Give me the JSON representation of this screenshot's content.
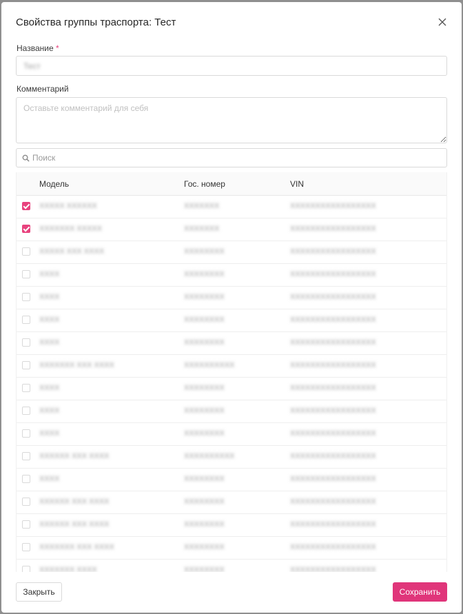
{
  "dialog": {
    "title": "Свойства группы траспорта: Тест",
    "name_label": "Название",
    "required_mark": "*",
    "name_value": "Тест",
    "comment_label": "Комментарий",
    "comment_placeholder": "Оставьте комментарий для себя",
    "search_placeholder": "Поиск",
    "close_label": "Закрыть",
    "save_label": "Сохранить"
  },
  "colors": {
    "accent": "#e0357a"
  },
  "table": {
    "columns": [
      "Модель",
      "Гос. номер",
      "VIN"
    ],
    "rows": [
      {
        "checked": true,
        "model": "XXXXX XXXXXX",
        "plate": "XXXXXXX",
        "vin": "XXXXXXXXXXXXXXXXX"
      },
      {
        "checked": true,
        "model": "XXXXXXX XXXXX",
        "plate": "XXXXXXX",
        "vin": "XXXXXXXXXXXXXXXXX"
      },
      {
        "checked": false,
        "model": "XXXXX XXX XXXX",
        "plate": "XXXXXXXX",
        "vin": "XXXXXXXXXXXXXXXXX"
      },
      {
        "checked": false,
        "model": "XXXX",
        "plate": "XXXXXXXX",
        "vin": "XXXXXXXXXXXXXXXXX"
      },
      {
        "checked": false,
        "model": "XXXX",
        "plate": "XXXXXXXX",
        "vin": "XXXXXXXXXXXXXXXXX"
      },
      {
        "checked": false,
        "model": "XXXX",
        "plate": "XXXXXXXX",
        "vin": "XXXXXXXXXXXXXXXXX"
      },
      {
        "checked": false,
        "model": "XXXX",
        "plate": "XXXXXXXX",
        "vin": "XXXXXXXXXXXXXXXXX"
      },
      {
        "checked": false,
        "model": "XXXXXXX XXX XXXX",
        "plate": "XXXXXXXXXX",
        "vin": "XXXXXXXXXXXXXXXXX"
      },
      {
        "checked": false,
        "model": "XXXX",
        "plate": "XXXXXXXX",
        "vin": "XXXXXXXXXXXXXXXXX"
      },
      {
        "checked": false,
        "model": "XXXX",
        "plate": "XXXXXXXX",
        "vin": "XXXXXXXXXXXXXXXXX"
      },
      {
        "checked": false,
        "model": "XXXX",
        "plate": "XXXXXXXX",
        "vin": "XXXXXXXXXXXXXXXXX"
      },
      {
        "checked": false,
        "model": "XXXXXX XXX XXXX",
        "plate": "XXXXXXXXXX",
        "vin": "XXXXXXXXXXXXXXXXX"
      },
      {
        "checked": false,
        "model": "XXXX",
        "plate": "XXXXXXXX",
        "vin": "XXXXXXXXXXXXXXXXX"
      },
      {
        "checked": false,
        "model": "XXXXXX XXX XXXX",
        "plate": "XXXXXXXX",
        "vin": "XXXXXXXXXXXXXXXXX"
      },
      {
        "checked": false,
        "model": "XXXXXX XXX XXXX",
        "plate": "XXXXXXXX",
        "vin": "XXXXXXXXXXXXXXXXX"
      },
      {
        "checked": false,
        "model": "XXXXXXX XXX XXXX",
        "plate": "XXXXXXXX",
        "vin": "XXXXXXXXXXXXXXXXX"
      },
      {
        "checked": false,
        "model": "XXXXXXX XXXX",
        "plate": "XXXXXXXX",
        "vin": "XXXXXXXXXXXXXXXXX"
      }
    ]
  }
}
